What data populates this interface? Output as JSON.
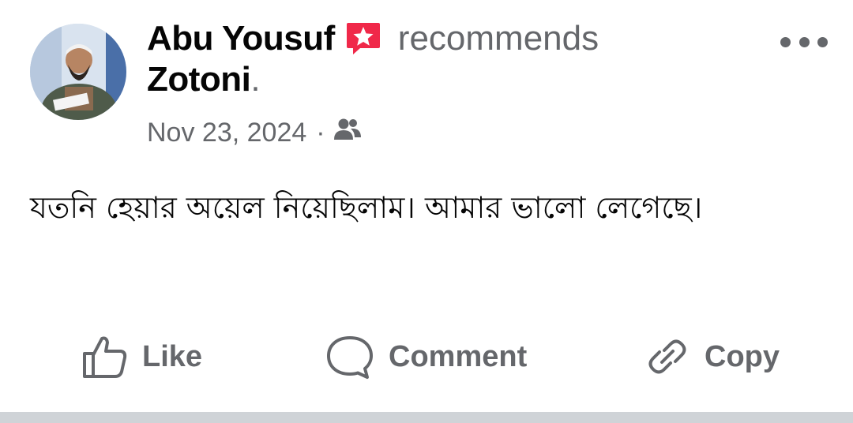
{
  "post": {
    "author_name_line1": "Abu Yousuf",
    "author_name_line2": "Zotoni",
    "author_trailing_dot": ".",
    "action_verb": "recommends",
    "date": "Nov 23, 2024",
    "separator": "·",
    "audience_icon": "friends-icon",
    "recommend_icon": "recommend-star-icon",
    "more_icon": "more-options-icon",
    "body_text": "যতনি হেয়ার অয়েল নিয়েছিলাম। আমার ভালো লেগেছে।"
  },
  "actions": {
    "like_label": "Like",
    "comment_label": "Comment",
    "copy_label": "Copy"
  },
  "colors": {
    "primary_text": "#050505",
    "secondary_text": "#65676b",
    "recommend_badge": "#f02849"
  }
}
